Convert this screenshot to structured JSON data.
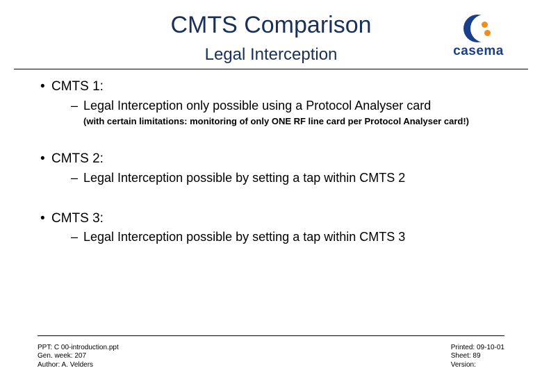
{
  "header": {
    "title": "CMTS Comparison",
    "subtitle": "Legal Interception",
    "logo_text": "casema"
  },
  "body": {
    "s1": {
      "heading": "CMTS 1:",
      "line": "Legal Interception only possible using a Protocol Analyser card",
      "note": "(with certain limitations: monitoring of only ONE RF line card per Protocol Analyser card!)"
    },
    "s2": {
      "heading": "CMTS 2:",
      "line": "Legal Interception possible by setting a tap within CMTS 2"
    },
    "s3": {
      "heading": "CMTS 3:",
      "line": "Legal Interception possible by setting a tap within CMTS 3"
    }
  },
  "footer": {
    "left": "PPT: C 00-introduction.ppt\nGen. week: 207\nAuthor: A. Velders",
    "right": "Printed: 09-10-01\nSheet: 89\nVersion:"
  }
}
